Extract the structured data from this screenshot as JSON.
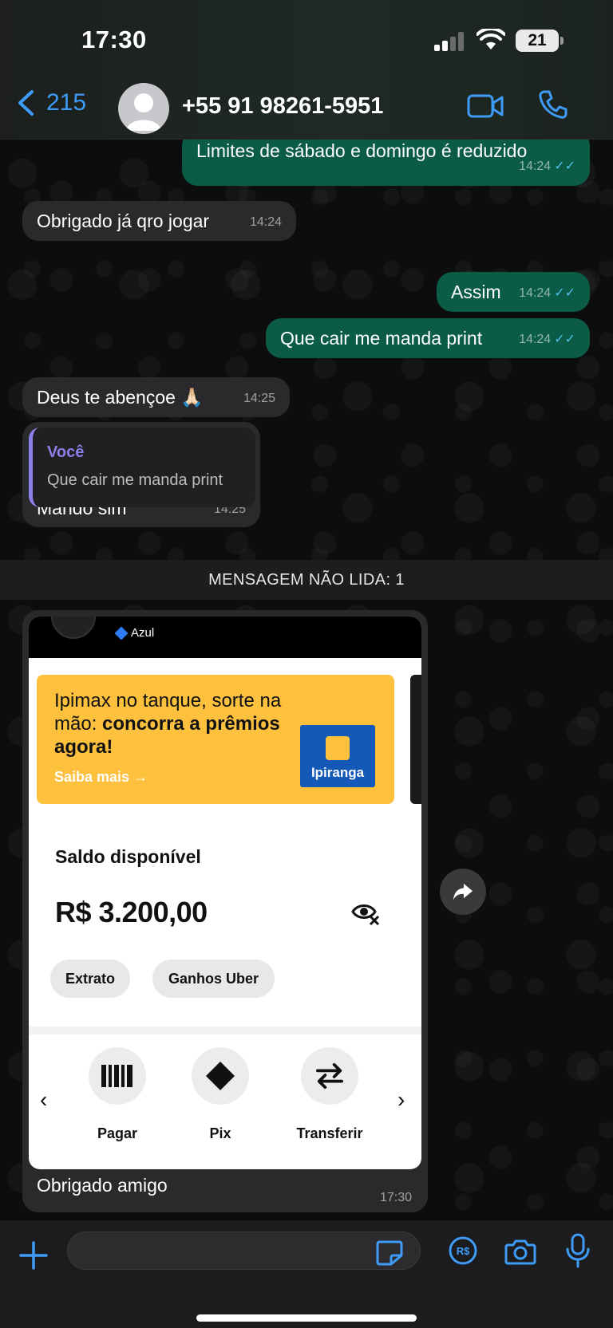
{
  "status_bar": {
    "time": "17:30",
    "battery": "21"
  },
  "header": {
    "back_count": "215",
    "contact": "+55 91 98261-5951"
  },
  "messages": [
    {
      "dir": "out",
      "text": "Limites de sábado e domingo é reduzido",
      "time": "14:24"
    },
    {
      "dir": "in",
      "text": "Obrigado já qro jogar",
      "time": "14:24"
    },
    {
      "dir": "out",
      "text": "Assim",
      "time": "14:24"
    },
    {
      "dir": "out",
      "text": "Que cair me manda print",
      "time": "14:24"
    },
    {
      "dir": "in",
      "text": "Deus te abençoe 🙏🏻",
      "time": "14:25"
    },
    {
      "dir": "in",
      "text": "Mando sim",
      "time": "14:25",
      "quote_author": "Você",
      "quote_text": "Que cair me manda print"
    }
  ],
  "unread_divider": "MENSAGEM NÃO LIDA: 1",
  "image_message": {
    "plan": "Azul",
    "promo_line1": "Ipimax no tanque, sorte na mão:",
    "promo_line2": "concorra a prêmios agora!",
    "promo_link": "Saiba mais →",
    "brand": "Ipiranga",
    "balance_label": "Saldo disponível",
    "balance_value": "R$ 3.200,00",
    "chip_extrato": "Extrato",
    "chip_uber": "Ganhos Uber",
    "actions": [
      "Pagar",
      "Pix",
      "Transferir"
    ],
    "arrow_left": "‹",
    "arrow_right": "›",
    "caption": "Obrigado amigo",
    "time": "17:30"
  },
  "input": {
    "placeholder": ""
  },
  "colors": {
    "accent": "#3e9bf7",
    "outgoing": "#0b5c47",
    "incoming": "#2a2a2c",
    "ticks": "#53bdeb",
    "quote": "#8b7fe8",
    "promo": "#fdc13e"
  }
}
